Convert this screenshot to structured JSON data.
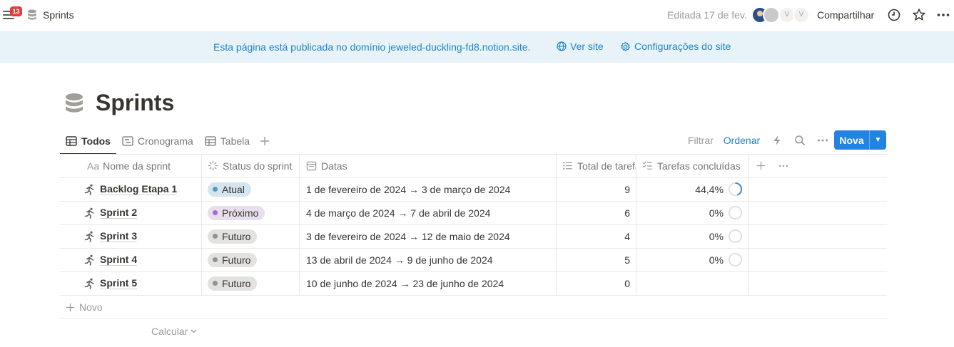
{
  "topbar": {
    "notification_count": "13",
    "breadcrumb": "Sprints",
    "edited": "Editada 17 de fev.",
    "avatars": [
      "",
      "",
      "V",
      "V"
    ],
    "share_label": "Compartilhar"
  },
  "banner": {
    "text": "Esta página está publicada no domínio jeweled-duckling-fd8.notion.site.",
    "view_site": "Ver site",
    "site_settings": "Configurações do site"
  },
  "page": {
    "title": "Sprints"
  },
  "tabs": [
    {
      "label": "Todos",
      "icon": "table-icon",
      "active": true
    },
    {
      "label": "Cronograma",
      "icon": "timeline-icon",
      "active": false
    },
    {
      "label": "Tabela",
      "icon": "table-icon",
      "active": false
    }
  ],
  "toolbar": {
    "filter": "Filtrar",
    "sort": "Ordenar",
    "new": "Nova"
  },
  "table": {
    "columns": [
      "Nome da sprint",
      "Status do sprint",
      "Datas",
      "Total de tarefas",
      "Tarefas concluídas"
    ],
    "column_prefix": "Aa",
    "rows": [
      {
        "name": "Backlog Etapa 1",
        "status": "Atual",
        "dates": "1 de fevereiro de 2024 → 3 de março de 2024",
        "total": "9",
        "done": "44,4%",
        "progress": 0.444
      },
      {
        "name": "Sprint 2",
        "status": "Próximo",
        "dates": "4 de março de 2024 → 7 de abril de 2024",
        "total": "6",
        "done": "0%",
        "progress": 0
      },
      {
        "name": "Sprint 3",
        "status": "Futuro",
        "dates": "3 de fevereiro de 2024 → 12 de maio de 2024",
        "total": "4",
        "done": "0%",
        "progress": 0
      },
      {
        "name": "Sprint 4",
        "status": "Futuro",
        "dates": "13 de abril de 2024 → 9 de junho de 2024",
        "total": "5",
        "done": "0%",
        "progress": 0
      },
      {
        "name": "Sprint 5",
        "status": "Futuro",
        "dates": "10 de junho de 2024 → 23 de junho de 2024",
        "total": "0",
        "done": "",
        "progress": null
      }
    ],
    "new_row": "Novo",
    "calculate": "Calcular"
  },
  "status_colors": {
    "Atual": {
      "bg": "#d3e5ef",
      "dot": "#5b97bd"
    },
    "Próximo": {
      "bg": "#e8deee",
      "dot": "#9a6dd7"
    },
    "Futuro": {
      "bg": "#e3e2e0",
      "dot": "#91918e"
    }
  },
  "colors": {
    "accent": "#2383e2",
    "link": "#2383c4",
    "banner_bg": "#e7f3f8"
  }
}
